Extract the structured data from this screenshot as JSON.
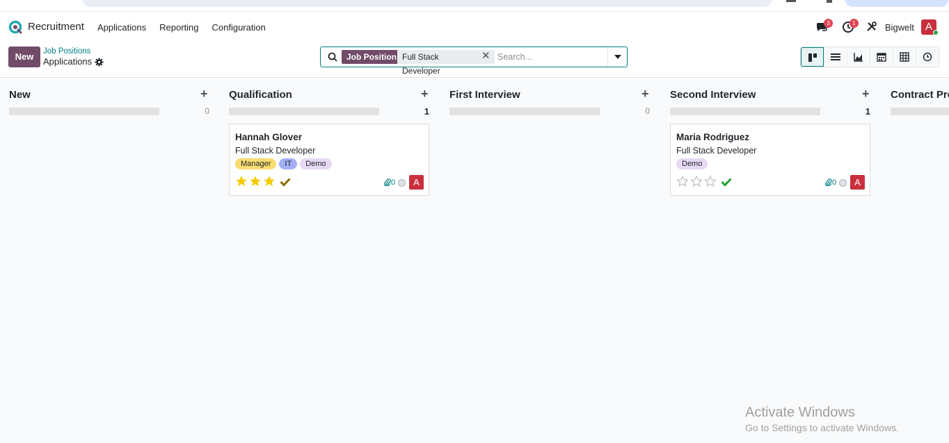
{
  "app": {
    "name": "Recruitment",
    "menu": [
      "Applications",
      "Reporting",
      "Configuration"
    ],
    "messages_badge": "3",
    "activity_badge": "1",
    "company": "Bigwelt",
    "user_initial": "A"
  },
  "control": {
    "new_label": "New",
    "breadcrumb": "Job Positions",
    "title": "Applications",
    "search": {
      "facet_label": "Job Position",
      "facet_value": "Full Stack Developer",
      "placeholder": "Search..."
    },
    "views": [
      "kanban-icon",
      "list-icon",
      "graph-icon",
      "calendar-icon",
      "pivot-icon",
      "activity-icon"
    ]
  },
  "columns": [
    {
      "title": "New",
      "count": "0"
    },
    {
      "title": "Qualification",
      "count": "1"
    },
    {
      "title": "First Interview",
      "count": "0"
    },
    {
      "title": "Second Interview",
      "count": "1"
    },
    {
      "title": "Contract Pro",
      "count": ""
    }
  ],
  "cards": [
    {
      "name": "Hannah Glover",
      "job": "Full Stack Developer",
      "tags": [
        "Manager",
        "IT",
        "Demo"
      ],
      "stars": 3,
      "attachments": "0",
      "avatar": "A"
    },
    {
      "name": "Maria Rodriguez",
      "job": "Full Stack Developer",
      "tags": [
        "Demo"
      ],
      "stars": 0,
      "attachments": "0",
      "avatar": "A"
    }
  ],
  "colors": {
    "brand": "#714b67",
    "teal": "#017e84",
    "tag_manager": "#f7dc6f",
    "tag_it": "#a4b0f5",
    "tag_demo": "#e6d9f5",
    "star": "#f3cc00",
    "check_done": "#8a6d00",
    "check_ok": "#1e9e2c"
  },
  "watermark": {
    "line1": "Activate Windows",
    "line2": "Go to Settings to activate Windows."
  }
}
